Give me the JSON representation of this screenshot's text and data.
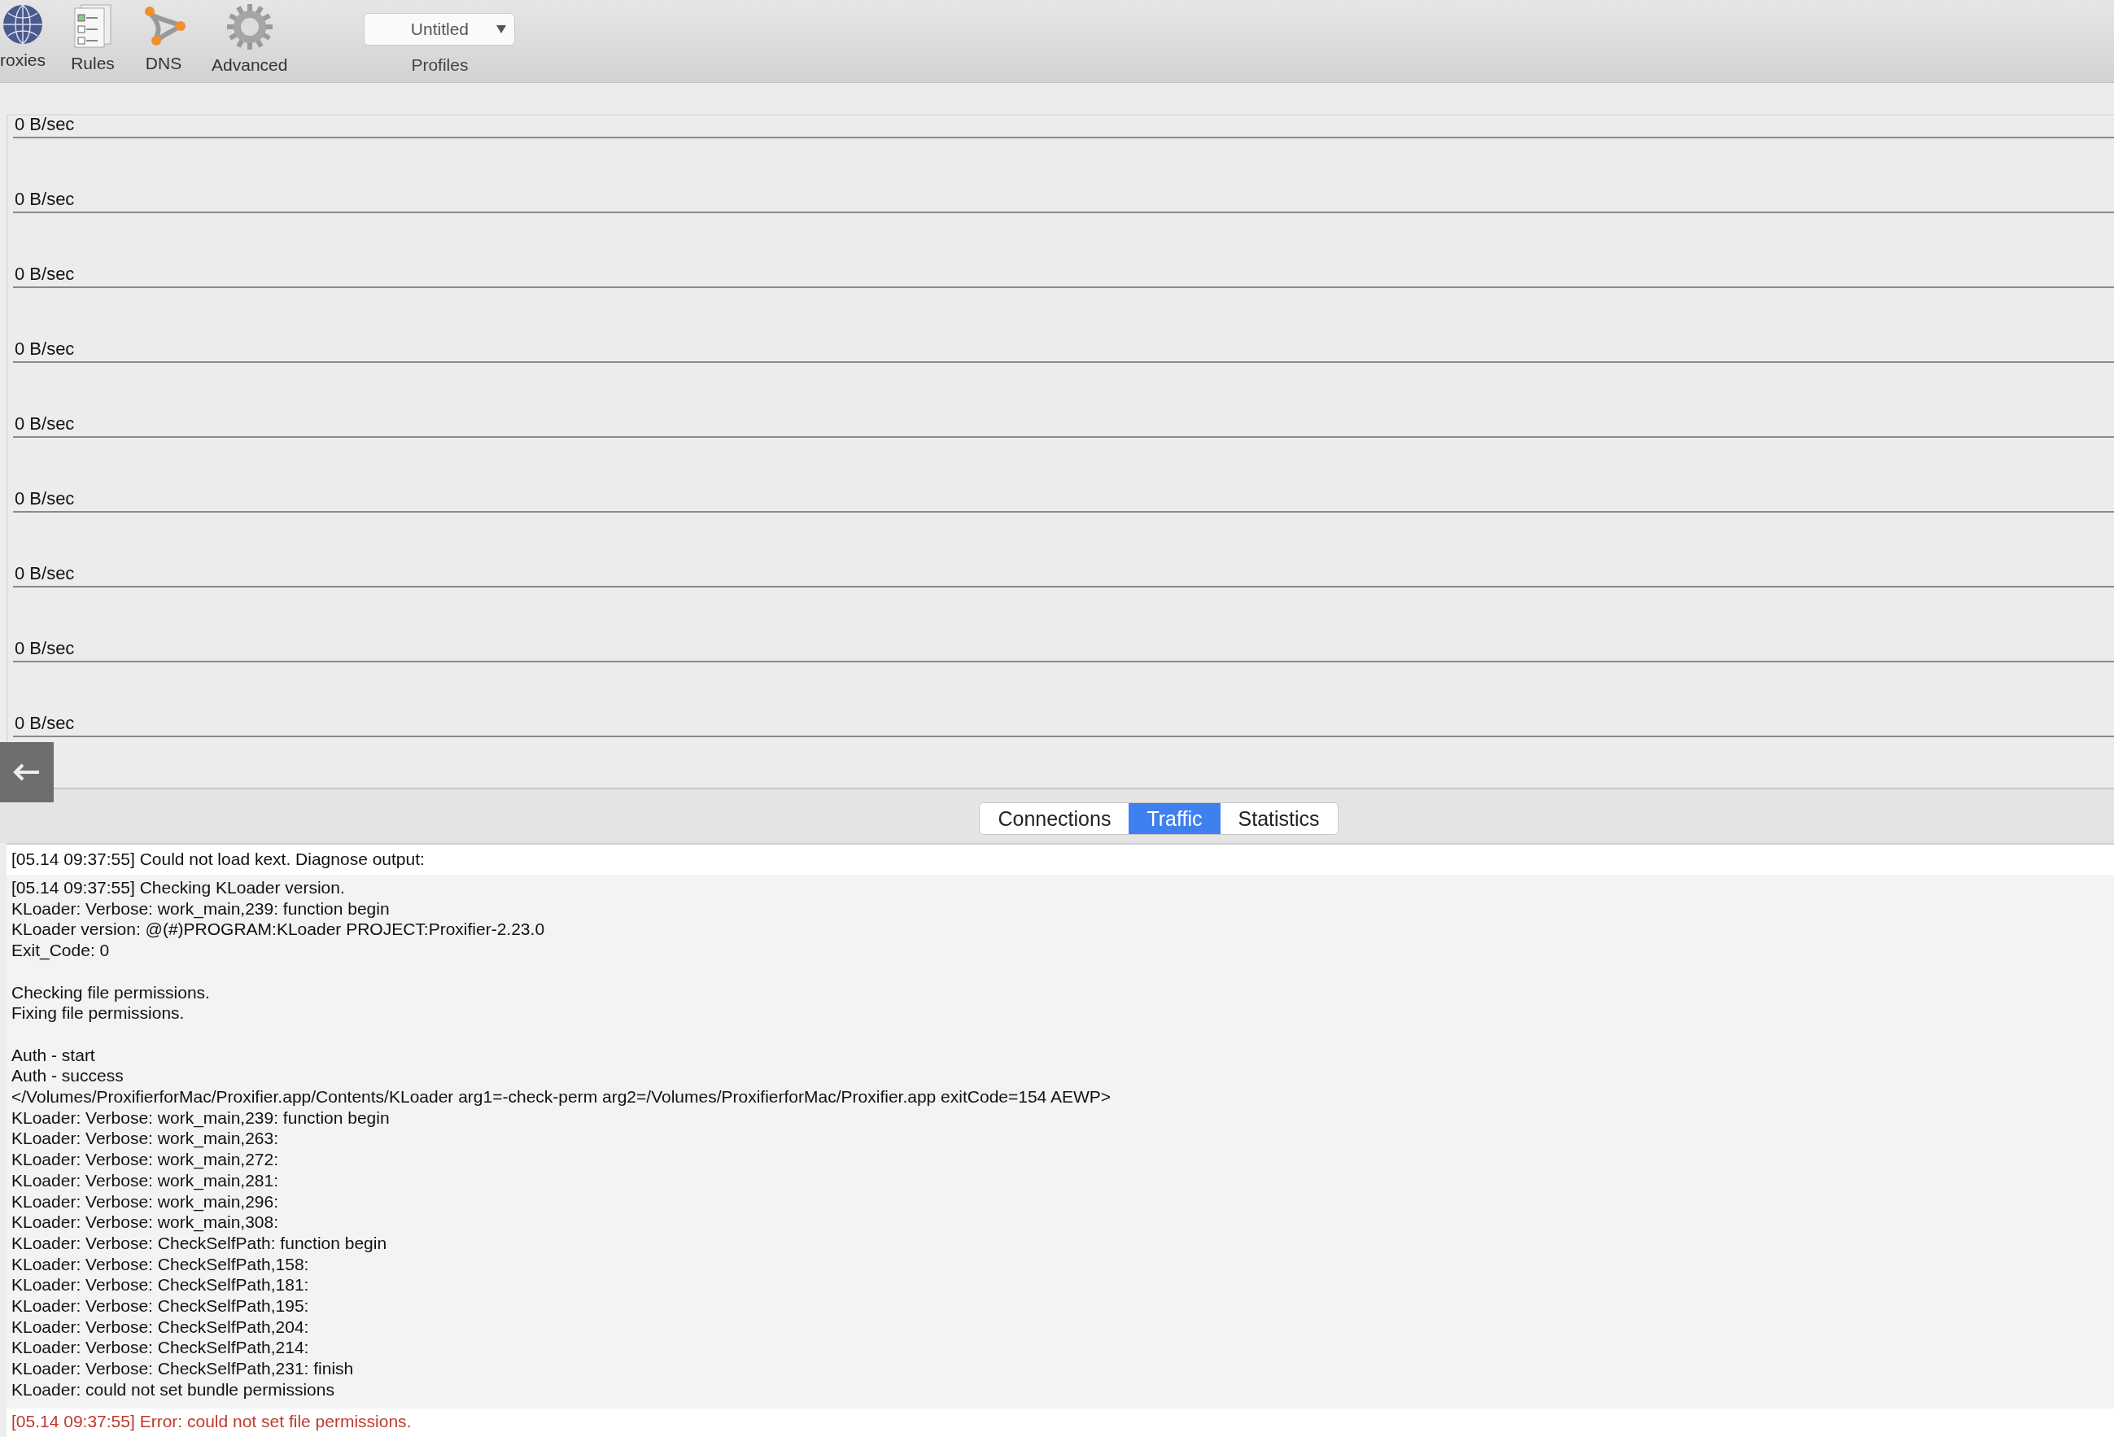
{
  "toolbar": {
    "items": [
      {
        "label": "roxies",
        "kind": "globe"
      },
      {
        "label": "Rules",
        "kind": "rules"
      },
      {
        "label": "DNS",
        "kind": "dns"
      },
      {
        "label": "Advanced",
        "kind": "gear"
      }
    ],
    "profile": {
      "value": "Untitled",
      "label": "Profiles"
    }
  },
  "traffic_graph": {
    "rows": [
      "0 B/sec",
      "0 B/sec",
      "0 B/sec",
      "0 B/sec",
      "0 B/sec",
      "0 B/sec",
      "0 B/sec",
      "0 B/sec",
      "0 B/sec"
    ]
  },
  "tabs": [
    {
      "label": "Connections",
      "selected": false
    },
    {
      "label": "Traffic",
      "selected": true
    },
    {
      "label": "Statistics",
      "selected": false
    }
  ],
  "log": [
    {
      "kind": "info",
      "text": "[05.14 09:37:55] Could not load kext. Diagnose output:"
    },
    {
      "kind": "detail",
      "groups": [
        [
          "[05.14 09:37:55] Checking KLoader version.",
          "KLoader: Verbose: work_main,239: function begin",
          "KLoader version: @(#)PROGRAM:KLoader  PROJECT:Proxifier-2.23.0",
          "Exit_Code: 0"
        ],
        [
          "Checking file permissions.",
          "Fixing file permissions."
        ],
        [
          "Auth - start",
          "Auth - success",
          "</Volumes/ProxifierforMac/Proxifier.app/Contents/KLoader arg1=-check-perm arg2=/Volumes/ProxifierforMac/Proxifier.app exitCode=154 AEWP>",
          "KLoader: Verbose: work_main,239: function begin",
          "KLoader: Verbose: work_main,263:",
          "KLoader: Verbose: work_main,272:",
          "KLoader: Verbose: work_main,281:",
          "KLoader: Verbose: work_main,296:",
          "KLoader: Verbose: work_main,308:",
          "KLoader: Verbose: CheckSelfPath: function begin",
          "KLoader: Verbose: CheckSelfPath,158:",
          "KLoader: Verbose: CheckSelfPath,181:",
          "KLoader: Verbose: CheckSelfPath,195:",
          "KLoader: Verbose: CheckSelfPath,204:",
          "KLoader: Verbose: CheckSelfPath,214:",
          "KLoader: Verbose: CheckSelfPath,231: finish",
          "KLoader: could not set bundle permissions"
        ]
      ]
    },
    {
      "kind": "error",
      "text": "[05.14 09:37:55] Error: could not set file permissions."
    }
  ]
}
